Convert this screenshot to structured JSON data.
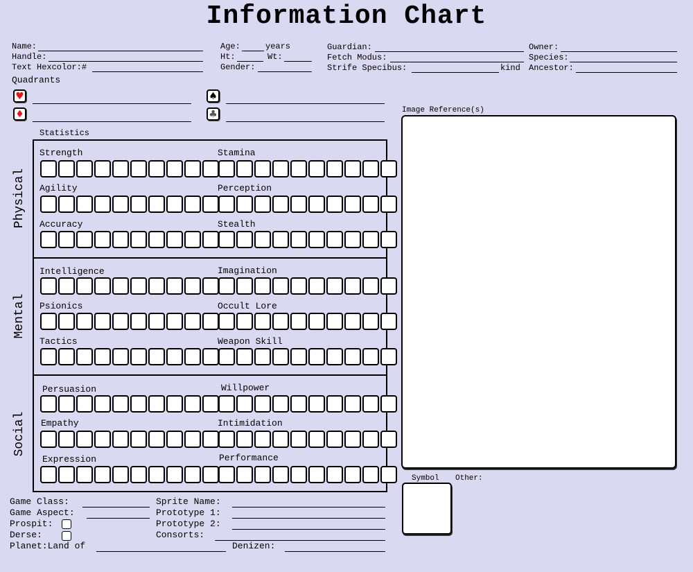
{
  "title": "Information Chart",
  "personal": {
    "name": "Name:",
    "handle": "Handle:",
    "hexcolor": "Text Hexcolor:#",
    "age": "Age:",
    "years": "years",
    "ht": "Ht:",
    "wt": "Wt:",
    "gender": "Gender:",
    "guardian": "Guardian:",
    "fetch": "Fetch Modus:",
    "strife": "Strife Specibus:",
    "kind": "kind",
    "owner": "Owner:",
    "species": "Species:",
    "ancestor": "Ancestor:"
  },
  "quadrants": {
    "label": "Quadrants",
    "heart": "♥",
    "diamond": "♦",
    "spade": "♠",
    "club": "♣",
    "colors": {
      "red": "#e8141c",
      "grey": "#555555"
    }
  },
  "stats": {
    "label": "Statistics",
    "sections": {
      "physical": "Physical",
      "mental": "Mental",
      "social": "Social"
    },
    "names": {
      "strength": "Strength",
      "stamina": "Stamina",
      "agility": "Agility",
      "perception": "Perception",
      "accuracy": "Accuracy",
      "stealth": "Stealth",
      "intelligence": "Intelligence",
      "imagination": "Imagination",
      "psionics": "Psionics",
      "occult": "Occult Lore",
      "tactics": "Tactics",
      "weapon": "Weapon Skill",
      "persuasion": "Persuasion",
      "willpower": "Willpower",
      "empathy": "Empathy",
      "intimidation": "Intimidation",
      "expression": "Expression",
      "performance": "Performance"
    }
  },
  "image_ref": "Image Reference(s)",
  "symbol": "Symbol",
  "other": "Other:",
  "game": {
    "class": "Game Class:",
    "aspect": "Game Aspect:",
    "prospit": "Prospit:",
    "derse": "Derse:",
    "planet": "Planet:Land of",
    "sprite": "Sprite Name:",
    "proto1": "Prototype 1:",
    "proto2": "Prototype 2:",
    "consorts": "Consorts:",
    "denizen": "Denizen:"
  }
}
